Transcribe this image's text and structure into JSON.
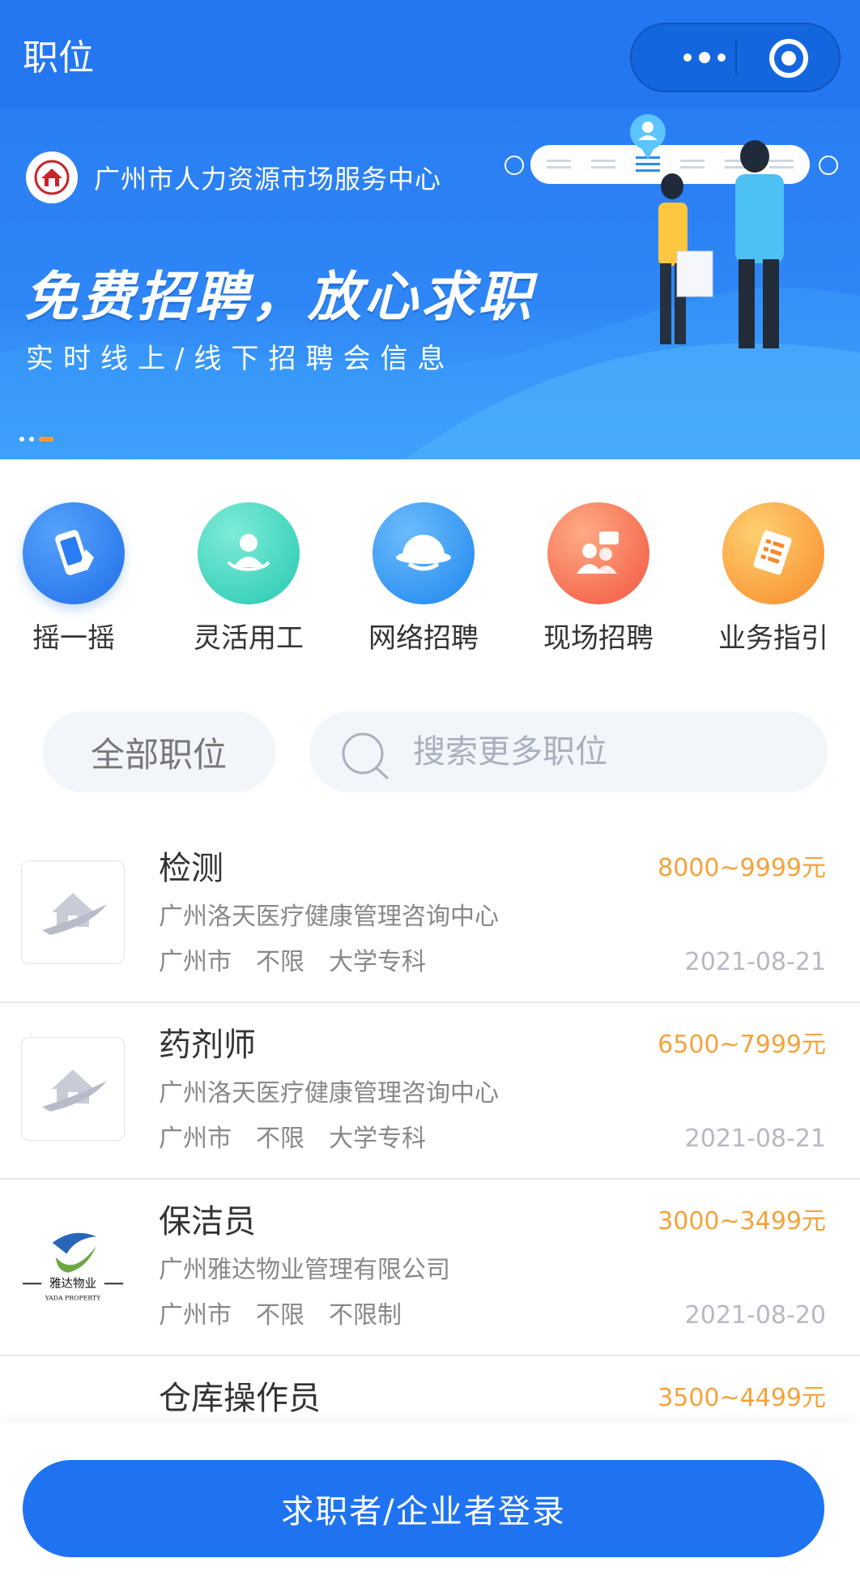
{
  "nav": {
    "title": "职位"
  },
  "banner": {
    "org_name": "广州市人力资源市场服务中心",
    "slogan": "免费招聘，放心求职",
    "subslogan": "实时线上/线下招聘会信息"
  },
  "quick_menu": [
    {
      "label": "摇一摇",
      "icon": "phone-shake-icon",
      "color_from": "#3e8ff6",
      "color_to": "#1f6fe8"
    },
    {
      "label": "灵活用工",
      "icon": "flexible-worker-icon",
      "color_from": "#5fe3cc",
      "color_to": "#26c8b0"
    },
    {
      "label": "网络招聘",
      "icon": "online-recruit-icon",
      "color_from": "#4aa6fa",
      "color_to": "#1d86ee"
    },
    {
      "label": "现场招聘",
      "icon": "onsite-recruit-icon",
      "color_from": "#ff9a73",
      "color_to": "#f2553f"
    },
    {
      "label": "业务指引",
      "icon": "business-guide-icon",
      "color_from": "#ffc04e",
      "color_to": "#f78a2b"
    }
  ],
  "filter": {
    "all_label": "全部职位",
    "search_placeholder": "搜索更多职位"
  },
  "jobs": [
    {
      "title": "检测",
      "salary": "8000~9999元",
      "company": "广州洛天医疗健康管理咨询中心",
      "tags": [
        "广州市",
        "不限",
        "大学专科"
      ],
      "date": "2021-08-21",
      "logo": "house-placeholder-icon"
    },
    {
      "title": "药剂师",
      "salary": "6500~7999元",
      "company": "广州洛天医疗健康管理咨询中心",
      "tags": [
        "广州市",
        "不限",
        "大学专科"
      ],
      "date": "2021-08-21",
      "logo": "house-placeholder-icon"
    },
    {
      "title": "保洁员",
      "salary": "3000~3499元",
      "company": "广州雅达物业管理有限公司",
      "tags": [
        "广州市",
        "不限",
        "不限制"
      ],
      "date": "2021-08-20",
      "logo": "yada-property-logo",
      "logo_text_cn": "雅达物业",
      "logo_text_en": "YADA PROPERTY"
    },
    {
      "title": "仓库操作员",
      "salary": "3500~4499元",
      "logo": "red-swoosh-logo"
    }
  ],
  "bottom": {
    "login_label": "求职者/企业者登录"
  },
  "colors": {
    "primary": "#2477f0",
    "salary": "#f5a23b",
    "button": "#1f73f1"
  }
}
